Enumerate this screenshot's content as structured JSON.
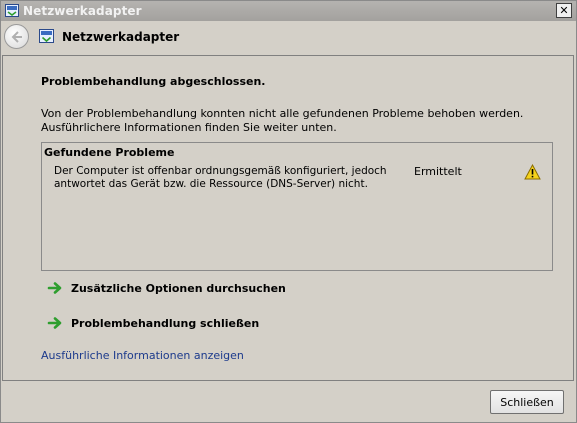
{
  "window": {
    "title": "Netzwerkadapter",
    "close_glyph": "✕"
  },
  "navbar": {
    "title": "Netzwerkadapter",
    "back_icon": "back-arrow-icon",
    "app_icon": "network-adapter-icon"
  },
  "main": {
    "heading": "Problembehandlung abgeschlossen.",
    "description": "Von der Problembehandlung konnten nicht alle gefundenen Probleme behoben werden. Ausführlichere Informationen finden Sie weiter unten.",
    "problems": {
      "title": "Gefundene Probleme",
      "items": [
        {
          "description": "Der Computer ist offenbar ordnungsgemäß konfiguriert, jedoch antwortet das Gerät bzw. die Ressource (DNS-Server) nicht.",
          "status": "Ermittelt",
          "icon": "warning-icon"
        }
      ]
    },
    "options": [
      {
        "label": "Zusätzliche Optionen durchsuchen",
        "icon": "green-arrow-icon"
      },
      {
        "label": "Problembehandlung schließen",
        "icon": "green-arrow-icon"
      }
    ],
    "details_link": "Ausführliche Informationen anzeigen"
  },
  "footer": {
    "close_button": "Schließen"
  },
  "colors": {
    "window_bg": "#d4d0c8",
    "link": "#1c3a8c",
    "arrow_green": "#2e9e2e",
    "warning_yellow": "#f5d21b"
  }
}
